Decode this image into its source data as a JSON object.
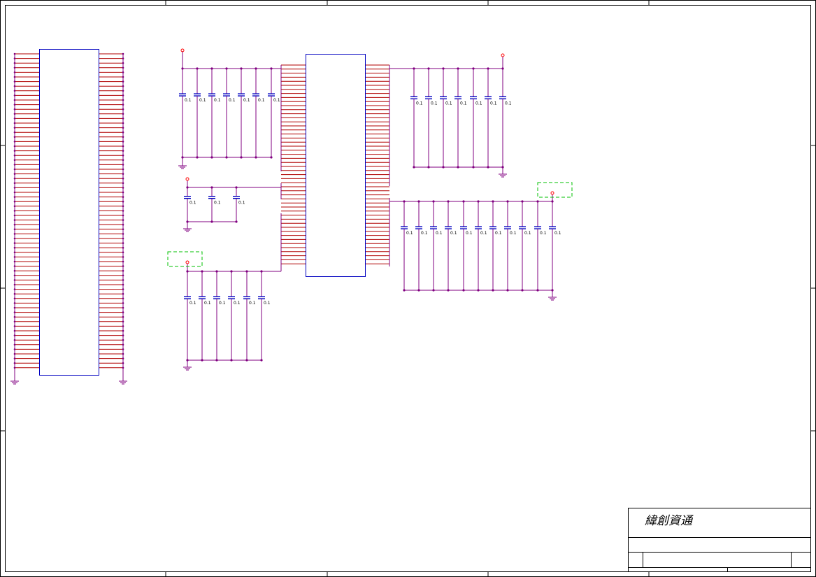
{
  "title_block": {
    "company": "緯創資通"
  },
  "colors": {
    "wire": "#800080",
    "pin": "#b00000",
    "component": "#0000c0",
    "power": "#ff0000",
    "dashed_box": "#00c000",
    "border": "#000000"
  },
  "capacitor_label": "0.1",
  "icons": [
    "ground-symbol-icon",
    "power-symbol-icon",
    "capacitor-icon",
    "ic-component-icon"
  ]
}
